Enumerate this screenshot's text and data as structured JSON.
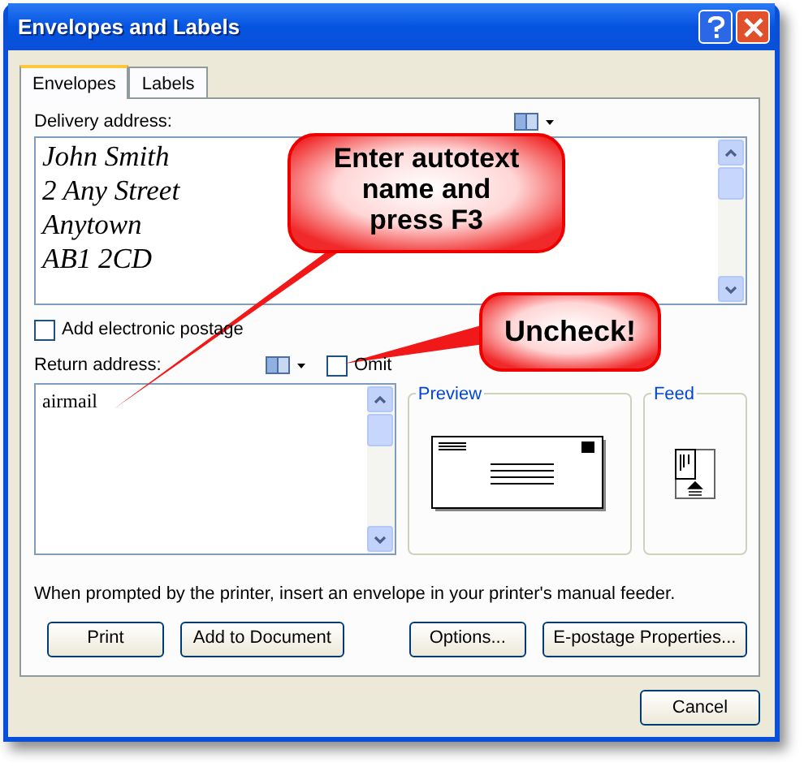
{
  "window": {
    "title": "Envelopes and Labels"
  },
  "tabs": [
    {
      "label": "Envelopes",
      "selected": true
    },
    {
      "label": "Labels",
      "selected": false
    }
  ],
  "delivery_address": {
    "label": "Delivery address:",
    "lines": [
      "John Smith",
      "2 Any Street",
      "Anytown",
      "AB1 2CD"
    ]
  },
  "electronic_postage": {
    "label": "Add electronic postage",
    "checked": false
  },
  "return_address": {
    "label": "Return address:",
    "value": "airmail",
    "omit": {
      "label": "Omit",
      "checked": false
    }
  },
  "preview": {
    "title": "Preview"
  },
  "feed": {
    "title": "Feed"
  },
  "note": "When prompted by the printer, insert an envelope in your printer's manual feeder.",
  "buttons": [
    "Print",
    "Add to Document",
    "Options...",
    "E-postage Properties..."
  ],
  "footer_buttons": [
    "Cancel"
  ],
  "callouts": [
    {
      "text": "Enter autotext name and press F3"
    },
    {
      "text": "Uncheck!"
    }
  ]
}
